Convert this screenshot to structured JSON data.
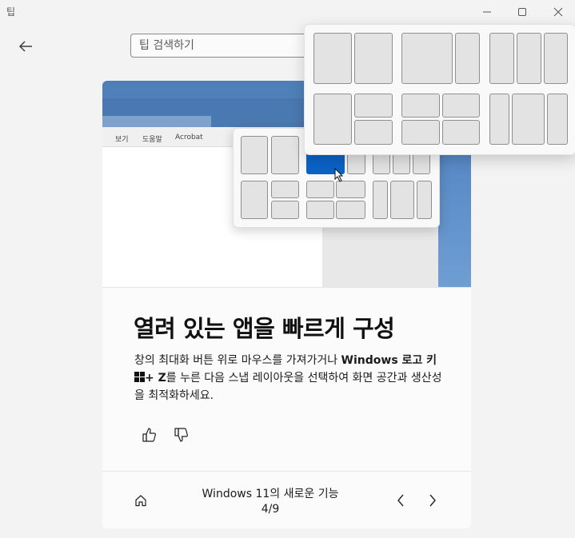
{
  "window": {
    "title": "팁",
    "controls": [
      "minimize-icon",
      "maximize-icon",
      "close-icon"
    ]
  },
  "search": {
    "placeholder": "팁 검색하기",
    "value": ""
  },
  "hero": {
    "ribbon_items": [
      "보기",
      "도움말",
      "Acrobat"
    ]
  },
  "tip": {
    "title": "열려 있는 앱을 빠르게 구성",
    "desc_part1": "창의 최대화 버튼 위로 마우스를 가져가거나 ",
    "desc_bold1": "Windows 로고 키",
    "desc_bold2": "+ Z",
    "desc_part2": "를 누른 다음 스냅 레이아웃을 선택하여 화면 공간과 생산성을 최적화하세요."
  },
  "feedback": {
    "like": "thumbs-up-icon",
    "dislike": "thumbs-down-icon"
  },
  "footer": {
    "collection": "Windows 11의 새로운 기능",
    "page": "4/9"
  },
  "colors": {
    "accent": "#0b63c7",
    "background": "#f3f3f3",
    "card": "#fbfbfb"
  }
}
